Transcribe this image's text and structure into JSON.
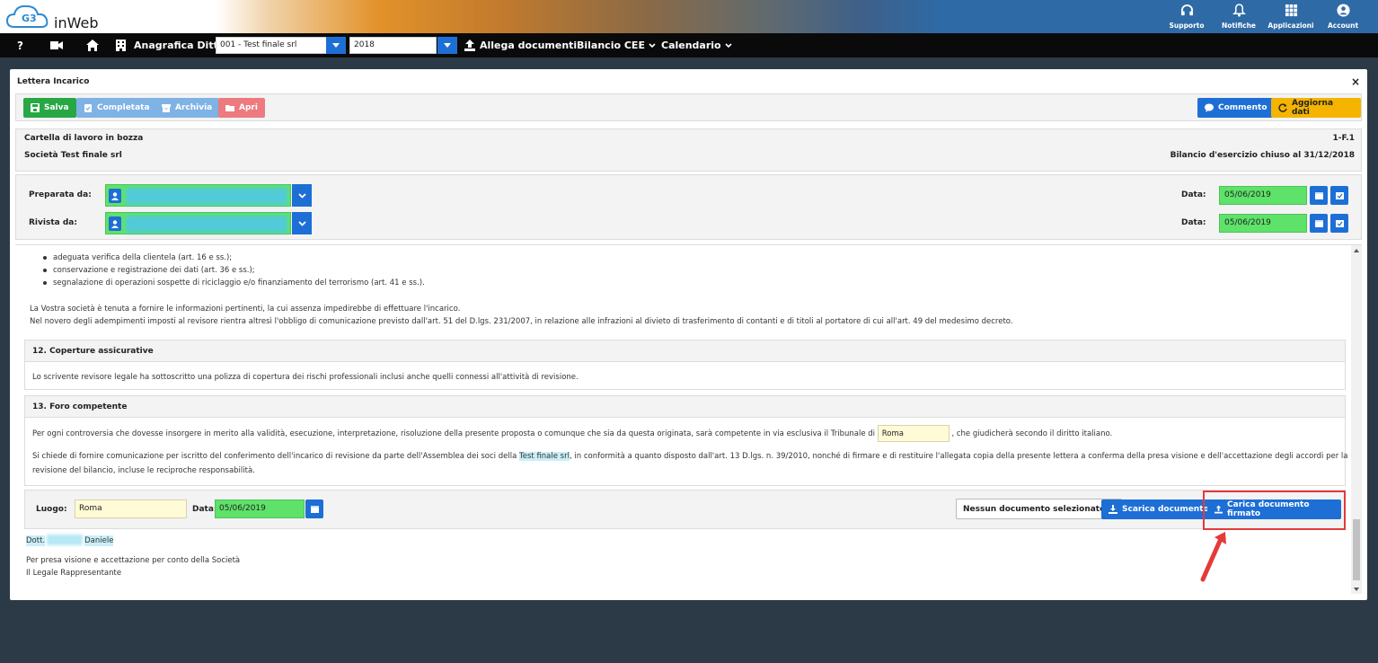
{
  "app": {
    "logo_text": "inWeb",
    "logo_mark": "G3"
  },
  "top_actions": [
    {
      "label": "Supporto",
      "icon": "headset-icon"
    },
    {
      "label": "Notifiche",
      "icon": "bell-icon"
    },
    {
      "label": "Applicazioni",
      "icon": "grid-icon"
    },
    {
      "label": "Account",
      "icon": "user-circle-icon"
    }
  ],
  "nav": {
    "help": "?",
    "anagrafica_label": "Anagrafica Ditte",
    "company_select": "001 - Test finale srl",
    "year_select": "2018",
    "allega_label": "Allega documenti",
    "bilancio_label": "Bilancio CEE",
    "calendario_label": "Calendario"
  },
  "panel": {
    "title": "Lettera Incarico",
    "close": "×"
  },
  "toolbar": {
    "salva": "Salva",
    "completata": "Completata",
    "archivia": "Archivia",
    "apri": "Apri",
    "commento": "Commento",
    "aggiorna": "Aggiorna dati"
  },
  "info": {
    "status": "Cartella di lavoro in bozza",
    "code": "1-F.1",
    "company": "Società Test finale srl",
    "bilancio": "Bilancio d'esercizio chiuso al 31/12/2018"
  },
  "prep": {
    "preparata_label": "Preparata da:",
    "rivista_label": "Rivista da:",
    "data_label": "Data:",
    "preparata_date": "05/06/2019",
    "rivista_date": "05/06/2019"
  },
  "content": {
    "bullets": [
      "adeguata verifica della clientela (art. 16 e ss.);",
      "conservazione e registrazione dei dati (art. 36 e ss.);",
      "segnalazione di operazioni sospette di riciclaggio e/o finanziamento del terrorismo (art. 41 e ss.)."
    ],
    "para1": "La Vostra società è tenuta a fornire le informazioni pertinenti, la cui assenza impedirebbe di effettuare l'incarico.",
    "para2": "Nel novero degli adempimenti imposti al revisore rientra altresì l'obbligo di comunicazione previsto dall'art. 51 del D.lgs. 231/2007, in relazione alle infrazioni al divieto di trasferimento di contanti e di titoli al portatore di cui all'art. 49 del medesimo decreto.",
    "sec12_title": "12. Coperture assicurative",
    "sec12_text": "Lo scrivente revisore legale ha sottoscritto una polizza di copertura dei rischi professionali inclusi anche quelli connessi all'attività di revisione.",
    "sec13_title": "13. Foro competente",
    "sec13_text_a": "Per ogni controversia che dovesse insorgere in merito alla validità, esecuzione, interpretazione, risoluzione della presente proposta o comunque che sia da questa originata, sarà competente in via esclusiva il Tribunale di",
    "sec13_tribunale": "Roma",
    "sec13_text_b": ", che giudicherà secondo il diritto italiano.",
    "sec13_p2_a": "Si chiede di fornire comunicazione per iscritto del conferimento dell'incarico di revisione da parte dell'Assemblea dei soci della",
    "sec13_p2_company": "Test finale srl",
    "sec13_p2_b": ", in conformità a quanto disposto dall'art. 13 D.lgs. n. 39/2010, nonché di firmare e di restituire l'allegata copia della presente lettera a conferma della presa visione e dell'accettazione degli accordi per la",
    "sec13_p2_c": "revisione del bilancio, incluse le reciproche responsabilità."
  },
  "sign": {
    "luogo_label": "Luogo:",
    "luogo_value": "Roma",
    "data_label": "Data:",
    "data_value": "05/06/2019",
    "nodoc": "Nessun documento selezionato...",
    "scarica": "Scarica documento",
    "carica": "Carica documento firmato"
  },
  "footer": {
    "dott": "Dott.",
    "name": "Daniele",
    "presa": "Per presa visione e accettazione per conto della Società",
    "legale": "Il Legale Rappresentante"
  },
  "colors": {
    "green": "#28a745",
    "blue": "#1d6fd6",
    "light_blue": "#7fb2e5",
    "pink": "#ec7a7e",
    "orange": "#f4b400",
    "field_green": "#5ee26a",
    "red_highlight": "#e43a3a"
  }
}
